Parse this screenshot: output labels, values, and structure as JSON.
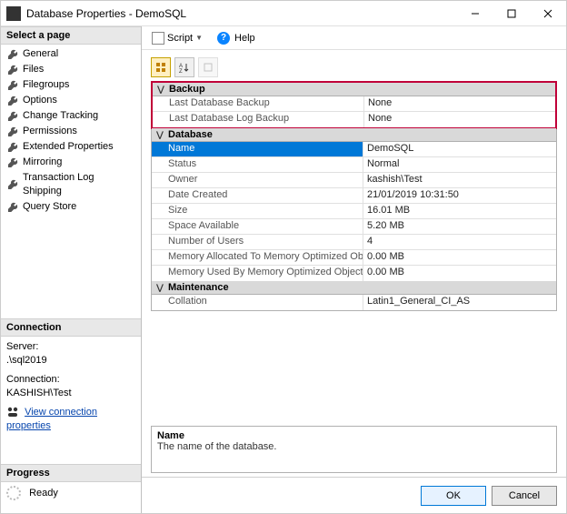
{
  "window": {
    "title": "Database Properties - DemoSQL"
  },
  "sidebar": {
    "select_page": "Select a page",
    "pages": [
      "General",
      "Files",
      "Filegroups",
      "Options",
      "Change Tracking",
      "Permissions",
      "Extended Properties",
      "Mirroring",
      "Transaction Log Shipping",
      "Query Store"
    ],
    "connection_header": "Connection",
    "server_label": "Server:",
    "server_value": ".\\sql2019",
    "connection_label": "Connection:",
    "connection_value": "KASHISH\\Test",
    "view_conn_link": "View connection properties",
    "progress_header": "Progress",
    "progress_status": "Ready"
  },
  "toolbar": {
    "script": "Script",
    "help": "Help"
  },
  "grid": {
    "categories": [
      {
        "name": "Backup",
        "highlight": true,
        "rows": [
          {
            "name": "Last Database Backup",
            "value": "None"
          },
          {
            "name": "Last Database Log Backup",
            "value": "None"
          }
        ]
      },
      {
        "name": "Database",
        "rows": [
          {
            "name": "Name",
            "value": "DemoSQL",
            "selected": true
          },
          {
            "name": "Status",
            "value": "Normal"
          },
          {
            "name": "Owner",
            "value": "kashish\\Test"
          },
          {
            "name": "Date Created",
            "value": "21/01/2019 10:31:50"
          },
          {
            "name": "Size",
            "value": "16.01 MB"
          },
          {
            "name": "Space Available",
            "value": "5.20 MB"
          },
          {
            "name": "Number of Users",
            "value": "4"
          },
          {
            "name": "Memory Allocated To Memory Optimized Ob",
            "value": "0.00 MB"
          },
          {
            "name": "Memory Used By Memory Optimized Objects",
            "value": "0.00 MB"
          }
        ]
      },
      {
        "name": "Maintenance",
        "rows": [
          {
            "name": "Collation",
            "value": "Latin1_General_CI_AS"
          }
        ]
      }
    ]
  },
  "description": {
    "name": "Name",
    "text": "The name of the database."
  },
  "buttons": {
    "ok": "OK",
    "cancel": "Cancel"
  }
}
